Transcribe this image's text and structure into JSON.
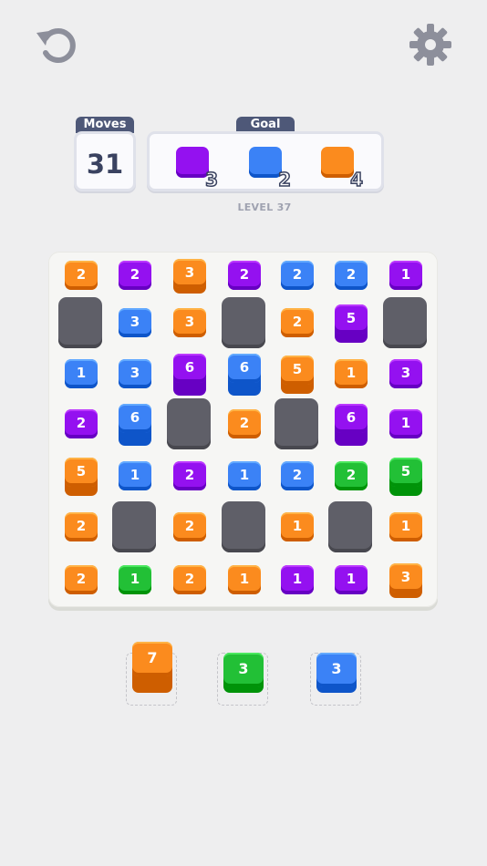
{
  "header": {
    "undo_icon": "undo-icon",
    "settings_icon": "gear-icon"
  },
  "stats": {
    "moves_label": "Moves",
    "moves_value": "31",
    "goal_label": "Goal",
    "goals": [
      {
        "color": "purple",
        "count": "3"
      },
      {
        "color": "blue",
        "count": "2"
      },
      {
        "color": "orange",
        "count": "4"
      }
    ],
    "level_label": "LEVEL 37"
  },
  "colors": {
    "orange": "#fb8b1e",
    "purple": "#9411f0",
    "blue": "#3b82f6",
    "green": "#22c036",
    "stone": "#5f5f68"
  },
  "board": {
    "rows": [
      [
        {
          "c": "orange",
          "n": "2",
          "h": 1
        },
        {
          "c": "purple",
          "n": "2",
          "h": 1
        },
        {
          "c": "orange",
          "n": "3",
          "h": 2
        },
        {
          "c": "purple",
          "n": "2",
          "h": 1
        },
        {
          "c": "blue",
          "n": "2",
          "h": 1
        },
        {
          "c": "blue",
          "n": "2",
          "h": 1
        },
        {
          "c": "purple",
          "n": "1",
          "h": 1
        }
      ],
      [
        {
          "c": "stone"
        },
        {
          "c": "blue",
          "n": "3",
          "h": 1
        },
        {
          "c": "orange",
          "n": "3",
          "h": 1
        },
        {
          "c": "stone"
        },
        {
          "c": "orange",
          "n": "2",
          "h": 1
        },
        {
          "c": "purple",
          "n": "5",
          "h": 3
        },
        {
          "c": "stone"
        }
      ],
      [
        {
          "c": "blue",
          "n": "1",
          "h": 1
        },
        {
          "c": "blue",
          "n": "3",
          "h": 1
        },
        {
          "c": "purple",
          "n": "6",
          "h": 4
        },
        {
          "c": "blue",
          "n": "6",
          "h": 4
        },
        {
          "c": "orange",
          "n": "5",
          "h": 3
        },
        {
          "c": "orange",
          "n": "1",
          "h": 1
        },
        {
          "c": "purple",
          "n": "3",
          "h": 1
        }
      ],
      [
        {
          "c": "purple",
          "n": "2",
          "h": 1
        },
        {
          "c": "blue",
          "n": "6",
          "h": 4
        },
        {
          "c": "stone"
        },
        {
          "c": "orange",
          "n": "2",
          "h": 1
        },
        {
          "c": "stone"
        },
        {
          "c": "purple",
          "n": "6",
          "h": 4
        },
        {
          "c": "purple",
          "n": "1",
          "h": 1
        }
      ],
      [
        {
          "c": "orange",
          "n": "5",
          "h": 3
        },
        {
          "c": "blue",
          "n": "1",
          "h": 1
        },
        {
          "c": "purple",
          "n": "2",
          "h": 1
        },
        {
          "c": "blue",
          "n": "1",
          "h": 1
        },
        {
          "c": "blue",
          "n": "2",
          "h": 1
        },
        {
          "c": "green",
          "n": "2",
          "h": 1
        },
        {
          "c": "green",
          "n": "5",
          "h": 3
        }
      ],
      [
        {
          "c": "orange",
          "n": "2",
          "h": 1
        },
        {
          "c": "stone"
        },
        {
          "c": "orange",
          "n": "2",
          "h": 1
        },
        {
          "c": "stone"
        },
        {
          "c": "orange",
          "n": "1",
          "h": 1
        },
        {
          "c": "stone"
        },
        {
          "c": "orange",
          "n": "1",
          "h": 1
        }
      ],
      [
        {
          "c": "orange",
          "n": "2",
          "h": 1
        },
        {
          "c": "green",
          "n": "1",
          "h": 1
        },
        {
          "c": "orange",
          "n": "2",
          "h": 1
        },
        {
          "c": "orange",
          "n": "1",
          "h": 1
        },
        {
          "c": "purple",
          "n": "1",
          "h": 1
        },
        {
          "c": "purple",
          "n": "1",
          "h": 1
        },
        {
          "c": "orange",
          "n": "3",
          "h": 2
        }
      ]
    ]
  },
  "tray": [
    {
      "c": "orange",
      "n": "7",
      "h": 5
    },
    {
      "c": "green",
      "n": "3",
      "h": 2
    },
    {
      "c": "blue",
      "n": "3",
      "h": 2
    }
  ]
}
